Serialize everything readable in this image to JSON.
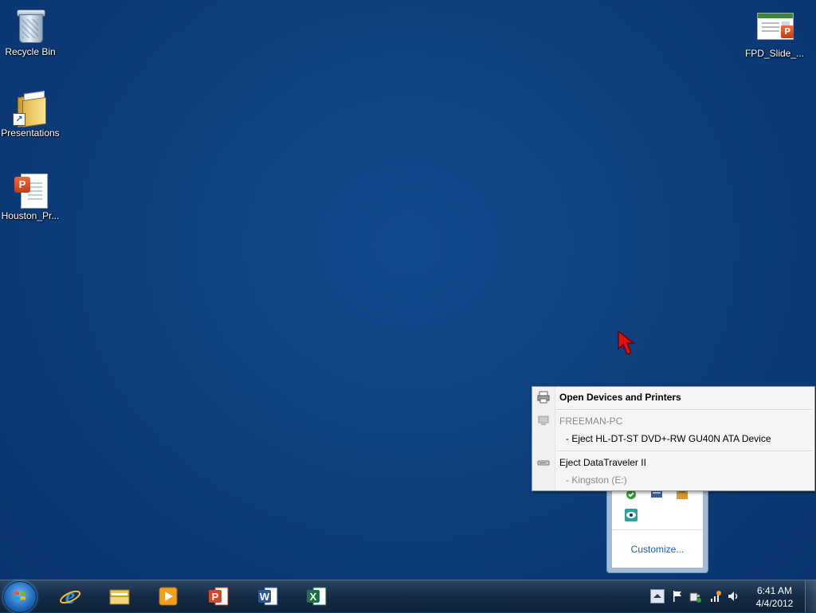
{
  "desktop": {
    "icons": [
      {
        "label": "Recycle Bin",
        "icon": "recycle-bin-icon"
      },
      {
        "label": "Presentations",
        "icon": "folder-icon"
      },
      {
        "label": "Houston_Pr...",
        "icon": "powerpoint-file-icon"
      },
      {
        "label": "FPD_Slide_...",
        "icon": "powerpoint-slide-file-icon"
      }
    ]
  },
  "context_menu": {
    "open_devices": "Open Devices and Printers",
    "computer_name": "FREEMAN-PC",
    "eject_dvd": "-  Eject HL-DT-ST DVD+-RW GU40N ATA Device",
    "eject_usb": "Eject DataTraveler II",
    "usb_volume": "-  Kingston (E:)"
  },
  "tray_popup": {
    "customize_label": "Customize..."
  },
  "taskbar": {
    "pinned": [
      {
        "name": "internet-explorer",
        "icon": "internet-explorer-icon"
      },
      {
        "name": "windows-explorer",
        "icon": "folder-icon"
      },
      {
        "name": "media-player",
        "icon": "media-player-icon"
      },
      {
        "name": "powerpoint",
        "icon": "powerpoint-icon"
      },
      {
        "name": "word",
        "icon": "word-icon"
      },
      {
        "name": "excel",
        "icon": "excel-icon"
      }
    ],
    "clock": {
      "time": "6:41 AM",
      "date": "4/4/2012"
    }
  },
  "colors": {
    "desktop_background": "#0d3d7a",
    "taskbar": "#142a45",
    "menu_background": "#f5f5f5",
    "link_blue": "#1e5bb4"
  }
}
